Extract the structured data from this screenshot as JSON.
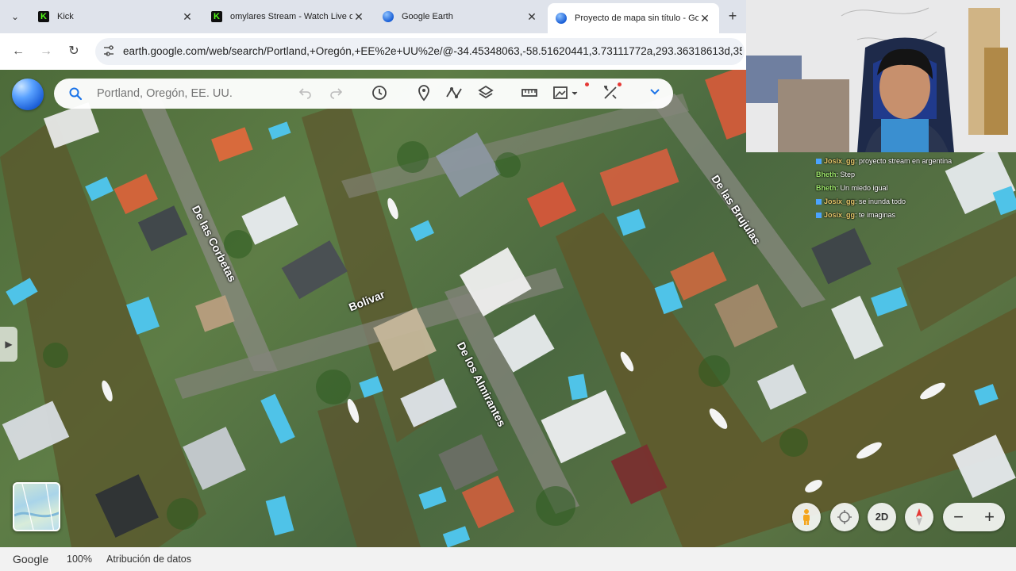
{
  "browser": {
    "tabs": [
      {
        "title": "Kick",
        "favicon": "kick-icon",
        "active": false
      },
      {
        "title": "omylares Stream - Watch Live on",
        "favicon": "kick-icon",
        "active": false
      },
      {
        "title": "Google Earth",
        "favicon": "google-earth-icon",
        "active": false
      },
      {
        "title": "Proyecto de mapa sin título - Goo",
        "favicon": "google-earth-icon",
        "active": true
      }
    ],
    "url": "earth.google.com/web/search/Portland,+Oregón,+EE%2e+UU%2e/@-34.45348063,-58.51620441,3.73111772a,293.36318613d,35"
  },
  "earth": {
    "search_placeholder": "Portland, Oregón, EE. UU.",
    "street_labels": {
      "corbetas": "De las Corbetas",
      "bolivar": "Bolivar",
      "almirantes": "De los Almirantes",
      "brujulas": "De las Brujulas"
    },
    "controls": {
      "view_2d": "2D"
    },
    "footer": {
      "brand": "Google",
      "zoom": "100%",
      "attribution": "Atribución de datos"
    }
  },
  "chat": [
    {
      "user": "Josix_gg",
      "text": ": proyecto stream en argentina"
    },
    {
      "user": "Bheth",
      "text": ": Step"
    },
    {
      "user": "Bheth",
      "text": ": Un miedo igual"
    },
    {
      "user": "Josix_gg",
      "text": ": se inunda todo"
    },
    {
      "user": "Josix_gg",
      "text": ": te imaginas"
    }
  ],
  "colors": {
    "accent": "#1a73e8",
    "chat_user": "#9ee86b",
    "chat_user_alt": "#e8c96b"
  }
}
